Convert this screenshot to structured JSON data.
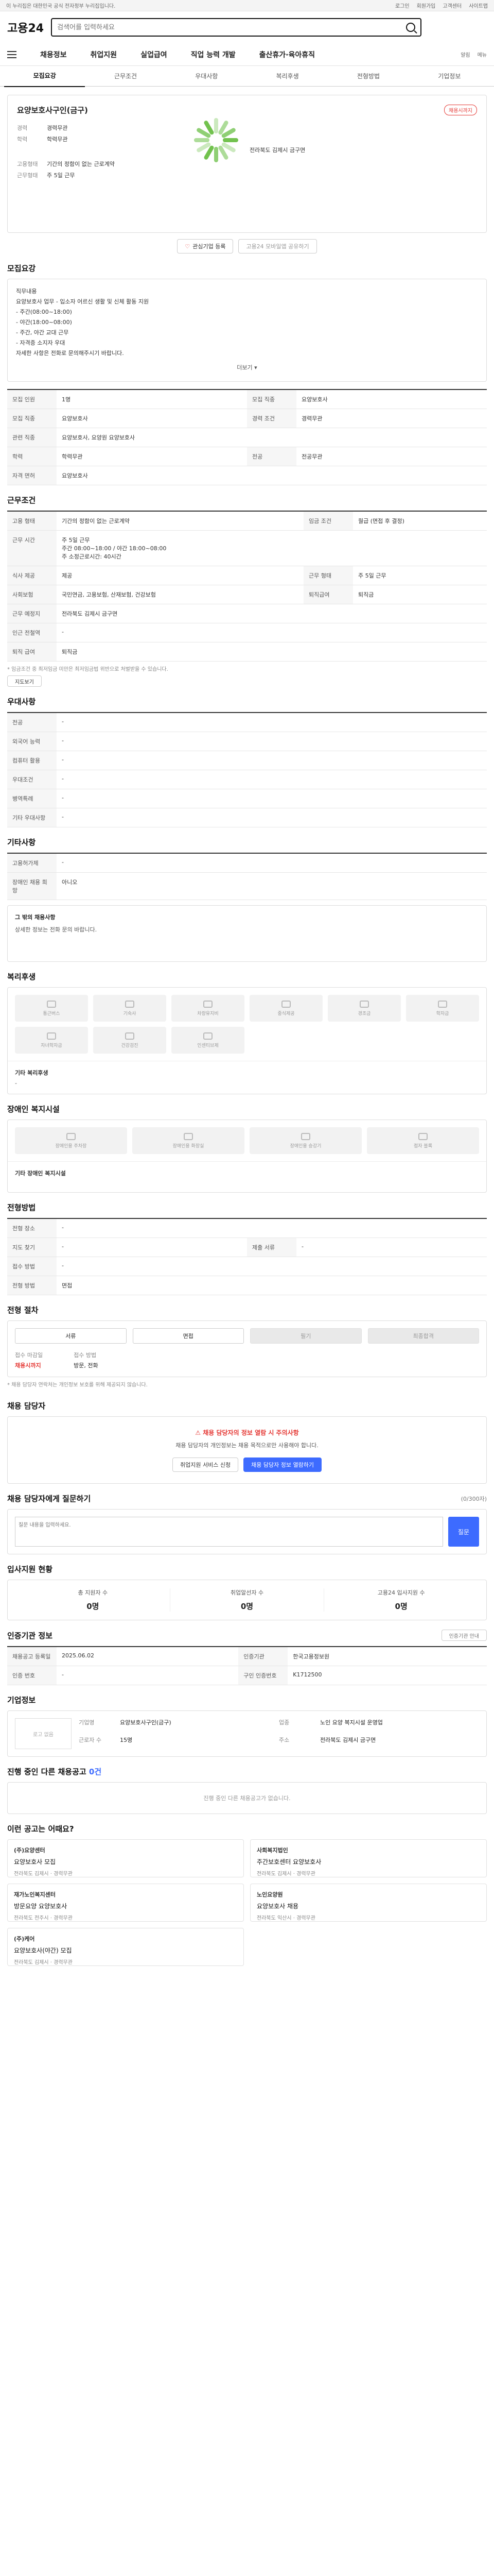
{
  "topbar": {
    "notice": "이 누리집은 대한민국 공식 전자정부 누리집입니다.",
    "links": [
      "로그인",
      "회원가입",
      "고객센터",
      "사이트맵"
    ]
  },
  "header": {
    "logo": "고용24",
    "search_placeholder": "검색어를 입력하세요"
  },
  "gnb": {
    "items": [
      "채용정보",
      "취업지원",
      "실업급여",
      "직업 능력 개발",
      "출산휴가·육아휴직"
    ],
    "util": [
      "알림",
      "메뉴"
    ]
  },
  "tabs": [
    {
      "label": "모집요강",
      "active": true
    },
    {
      "label": "근무조건",
      "active": false
    },
    {
      "label": "우대사항",
      "active": false
    },
    {
      "label": "복리후생",
      "active": false
    },
    {
      "label": "전형방법",
      "active": false
    },
    {
      "label": "기업정보",
      "active": false
    }
  ],
  "job": {
    "company": "요양보호사구인(금구)",
    "badge": "채용시까지",
    "fields": [
      {
        "k": "경력",
        "v": "경력무관"
      },
      {
        "k": "학력",
        "v": "학력무관"
      }
    ],
    "address": "전라북도 김제시 금구면",
    "conditions": [
      {
        "k": "고용형태",
        "v": "기간의 정함이 없는 근로계약"
      },
      {
        "k": "근무형태",
        "v": "주 5일 근무"
      }
    ],
    "scrap_label": "관심기업 등록",
    "share_label": "고용24 모바일앱 공유하기"
  },
  "sections": {
    "recruit_title": "모집요강",
    "recruit_more": "더보기 ▾",
    "recruit_text": [
      "직무내용",
      "요양보호사 업무 - 입소자 어르신 생활 및 신체 활동 지원",
      "- 주간(08:00~18:00)",
      "- 야간(18:00~08:00)",
      "- 주간, 야간 교대 근무",
      "- 자격증 소지자 우대",
      "자세한 사항은 전화로 문의해주시기 바랍니다."
    ],
    "recruit_table": [
      {
        "k": "모집 인원",
        "v": "1명",
        "k2": "모집 직종",
        "v2": "요양보호사"
      },
      {
        "k": "모집 직종",
        "v": "요양보호사",
        "k2": "경력 조건",
        "v2": "경력무관"
      },
      {
        "k": "관련 직종",
        "v": "요양보호사, 요양원 요양보호사",
        "k2": "",
        "v2": ""
      },
      {
        "k": "학력",
        "v": "학력무관",
        "k2": "전공",
        "v2": "전공무관"
      },
      {
        "k": "자격 면허",
        "v": "요양보호사",
        "k2": "",
        "v2": ""
      }
    ],
    "work_title": "근무조건",
    "work_table": [
      {
        "k": "고용 형태",
        "v": "기간의 정함이 없는 근로계약",
        "k2": "임금 조건",
        "v2": "월급 (면접 후 결정)"
      },
      {
        "k": "근무 시간",
        "v": "주 5일 근무\n주간 08:00~18:00 / 야간 18:00~08:00\n주 소정근로시간: 40시간",
        "k2": "",
        "v2": ""
      },
      {
        "k": "식사 제공",
        "v": "제공",
        "k2": "근무 형태",
        "v2": "주 5일 근무"
      },
      {
        "k": "사회보험",
        "v": "국민연금, 고용보험, 산재보험, 건강보험",
        "k2": "퇴직급여",
        "v2": "퇴직금"
      },
      {
        "k": "근무 예정지",
        "v": "전라북도 김제시 금구면",
        "k2": "",
        "v2": ""
      },
      {
        "k": "인근 전철역",
        "v": "-",
        "k2": "",
        "v2": ""
      },
      {
        "k": "퇴직 급여",
        "v": "퇴직금",
        "k2": "",
        "v2": ""
      }
    ],
    "work_note": "* 임금조건 중 최저임금 미만은 최저임금법 위반으로 처벌받을 수 있습니다.",
    "map_label": "지도보기",
    "pref_title": "우대사항",
    "pref_table": [
      {
        "k": "전공",
        "v": "-"
      },
      {
        "k": "외국어 능력",
        "v": "-"
      },
      {
        "k": "컴퓨터 활용",
        "v": "-"
      },
      {
        "k": "우대조건",
        "v": "-"
      },
      {
        "k": "병역특례",
        "v": "-"
      },
      {
        "k": "기타 우대사항",
        "v": "-"
      }
    ],
    "extra_title": "기타사항",
    "extra_table": [
      {
        "k": "고용허가제",
        "v": "-"
      },
      {
        "k": "장애인 채용 희망",
        "v": "아니오"
      }
    ],
    "extra_note_title": "그 밖의 채용사항",
    "extra_note": "상세한 정보는 전화 문의 바랍니다.",
    "welfare_title": "복리후생",
    "welfare_items": [
      "통근버스",
      "기숙사",
      "차량유지비",
      "중식제공",
      "경조금",
      "학자금"
    ],
    "welfare_items2": [
      "자녀학자금",
      "건강검진",
      "인센티브제"
    ],
    "welfare_other_label": "기타 복리후생",
    "welfare_other": "-",
    "disabled_title": "장애인 복지시설",
    "disabled_items": [
      "장애인용 주차장",
      "장애인용 화장실",
      "장애인용 승강기",
      "점자 블록"
    ],
    "disabled_other_label": "기타 장애인 복지시설",
    "selection_title": "전형방법",
    "selection_table": [
      {
        "k": "전형 장소",
        "v": "-"
      },
      {
        "k": "지도 찾기",
        "v": "-",
        "k2": "제출 서류",
        "v2": "-"
      },
      {
        "k": "접수 방법",
        "v": "-",
        "k2": "",
        "v2": ""
      },
      {
        "k": "전형 방법",
        "v": "면접",
        "k2": "",
        "v2": ""
      }
    ],
    "process_title": "전형 절차",
    "steps": [
      {
        "label": "서류",
        "off": false
      },
      {
        "label": "면접",
        "off": false
      },
      {
        "label": "필기",
        "off": true
      },
      {
        "label": "최종합격",
        "off": true
      }
    ],
    "deadline_label": "접수 마감일",
    "deadline_value": "채용시까지",
    "contact_label": "접수 방법",
    "contact_value": "방문, 전화",
    "warning_text": "* 채용 담당자 연락처는 개인정보 보호를 위해 제공되지 않습니다.",
    "apply_title": "채용 담당자",
    "apply_warn": "채용 담당자의 정보 열람 시 주의사항",
    "apply_desc": "채용 담당자의 개인정보는 채용 목적으로만 사용해야 합니다.",
    "apply_btn1": "취업지원 서비스 신청",
    "apply_btn2": "채용 담당자 정보 열람하기",
    "qa_title": "채용 담당자에게 질문하기",
    "qa_counter": "(0/300자)",
    "qa_placeholder": "질문 내용을 입력하세요.",
    "qa_submit": "질문",
    "stats_title": "입사지원 현황",
    "stats": [
      {
        "lbl": "총 지원자 수",
        "val": "0명"
      },
      {
        "lbl": "취업알선자 수",
        "val": "0명"
      },
      {
        "lbl": "고용24 입사지원 수",
        "val": "0명"
      }
    ],
    "meta_title": "인증기관 정보",
    "meta_btn": "인증기관 안내",
    "meta_table": [
      {
        "k": "채용공고 등록일",
        "v": "2025.06.02",
        "k2": "인증기관",
        "v2": "한국고용정보원"
      },
      {
        "k": "인증 번호",
        "v": "-",
        "k2": "구인 인증번호",
        "v2": "K1712500"
      }
    ],
    "company_title": "기업정보",
    "company_logo": "로고 없음",
    "company_meta": [
      {
        "k": "기업명",
        "v": "요양보호사구인(금구)"
      },
      {
        "k": "업종",
        "v": "노인 요양 복지시설 운영업"
      },
      {
        "k": "근로자 수",
        "v": "15명"
      },
      {
        "k": "주소",
        "v": "전라북도 김제시 금구면"
      }
    ],
    "ongoing_title": "진행 중인 다른 채용공고",
    "ongoing_count": "0건",
    "ongoing_empty": "진행 중인 다른 채용공고가 없습니다.",
    "rec_title": "이런 공고는 어때요?",
    "recs": [
      {
        "company": "(주)요양센터",
        "title": "요양보호사 모집",
        "sub": "전라북도 김제시 · 경력무관"
      },
      {
        "company": "사회복지법인",
        "title": "주간보호센터 요양보호사",
        "sub": "전라북도 김제시 · 경력무관"
      },
      {
        "company": "재가노인복지센터",
        "title": "방문요양 요양보호사",
        "sub": "전라북도 전주시 · 경력무관"
      },
      {
        "company": "노인요양원",
        "title": "요양보호사 채용",
        "sub": "전라북도 익산시 · 경력무관"
      },
      {
        "company": "(주)케어",
        "title": "요양보호사(야간) 모집",
        "sub": "전라북도 김제시 · 경력무관"
      }
    ]
  }
}
